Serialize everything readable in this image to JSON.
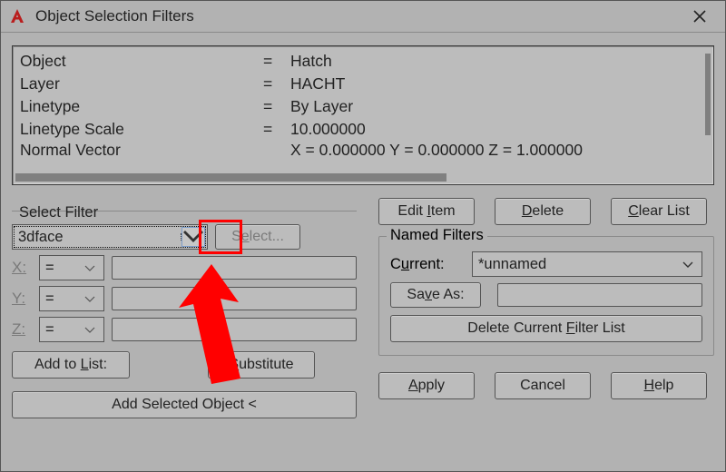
{
  "window": {
    "title": "Object Selection Filters"
  },
  "list": {
    "rows": [
      {
        "prop": "Object",
        "op": "=",
        "val": "Hatch"
      },
      {
        "prop": "Layer",
        "op": "=",
        "val": "HACHT"
      },
      {
        "prop": "Linetype",
        "op": "=",
        "val": "By Layer"
      },
      {
        "prop": "Linetype Scale",
        "op": "=",
        "val": "10.000000"
      }
    ],
    "partial": {
      "prop": "Normal Vector",
      "val": "X =   0.000000     Y =  0.000000     Z =  1.000000"
    }
  },
  "select_filter": {
    "label": "Select Filter",
    "value": "3dface",
    "select_btn": "Select...",
    "x_label": "X:",
    "y_label": "Y:",
    "z_label": "Z:",
    "op": "=",
    "add_to_list": "Add to List:",
    "substitute": "Substitute",
    "add_selected": "Add Selected Object <"
  },
  "right": {
    "edit_item": "Edit Item",
    "delete": "Delete",
    "clear_list": "Clear List",
    "named_filters": "Named Filters",
    "current_label": "Current:",
    "current_value": "*unnamed",
    "save_as": "Save As:",
    "delete_current": "Delete Current Filter List",
    "apply": "Apply",
    "cancel": "Cancel",
    "help": "Help"
  },
  "icons": {
    "logo": "autocad-logo",
    "close": "close-icon",
    "chevron": "chevron-down-icon"
  },
  "colors": {
    "accent_red": "#ff0000"
  }
}
